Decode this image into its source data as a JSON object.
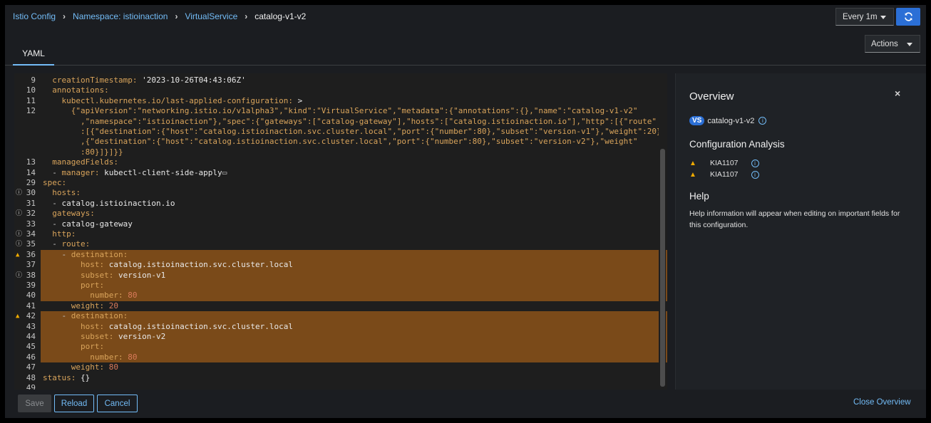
{
  "breadcrumb": {
    "items": [
      "Istio Config",
      "Namespace: istioinaction",
      "VirtualService"
    ],
    "current": "catalog-v1-v2"
  },
  "refresh": {
    "interval_label": "Every 1m"
  },
  "actions_label": "Actions",
  "tabs": {
    "yaml": "YAML"
  },
  "editor": {
    "lines": [
      {
        "n": "9",
        "mark": "",
        "hl": false,
        "html": "  <span class='k'>creationTimestamp:</span> <span class='s'>'2023-10-26T04:43:06Z'</span>"
      },
      {
        "n": "10",
        "mark": "",
        "hl": false,
        "html": "  <span class='k'>annotations:</span>"
      },
      {
        "n": "11",
        "mark": "",
        "hl": false,
        "html": "    <span class='k'>kubectl.kubernetes.io/last-applied-configuration:</span> <span class='s'>&gt;</span>"
      },
      {
        "n": "12",
        "mark": "",
        "hl": false,
        "html": "      <span class='k'>{\"apiVersion\":\"networking.istio.io/v1alpha3\",\"kind\":\"VirtualService\",\"metadata\":{\"annotations\":{},\"name\":\"catalog-v1-v2\"</span>"
      },
      {
        "n": "",
        "mark": "",
        "hl": false,
        "html": "        <span class='k'>,\"namespace\":\"istioinaction\"},\"spec\":{\"gateways\":[\"catalog-gateway\"],\"hosts\":[\"catalog.istioinaction.io\"],\"http\":[{\"route\"</span>"
      },
      {
        "n": "",
        "mark": "",
        "hl": false,
        "html": "        <span class='k'>:[{\"destination\":{\"host\":\"catalog.istioinaction.svc.cluster.local\",\"port\":{\"number\":80},\"subset\":\"version-v1\"},\"weight\":20}</span>"
      },
      {
        "n": "",
        "mark": "",
        "hl": false,
        "html": "        <span class='k'>,{\"destination\":{\"host\":\"catalog.istioinaction.svc.cluster.local\",\"port\":{\"number\":80},\"subset\":\"version-v2\"},\"weight\"</span>"
      },
      {
        "n": "",
        "mark": "",
        "hl": false,
        "html": "        <span class='k'>:80}]}]}}</span>"
      },
      {
        "n": "13",
        "mark": "",
        "hl": false,
        "html": "  <span class='k'>managedFields:</span>"
      },
      {
        "n": "14",
        "mark": "",
        "hl": false,
        "html": "  <span class='p'>-</span> <span class='k'>manager:</span> <span class='s'>kubectl-client-side-apply</span><span class='p'>▭</span>"
      },
      {
        "n": "29",
        "mark": "",
        "hl": false,
        "html": "<span class='k'>spec:</span>"
      },
      {
        "n": "30",
        "mark": "i",
        "hl": false,
        "html": "  <span class='k'>hosts:</span>"
      },
      {
        "n": "31",
        "mark": "",
        "hl": false,
        "html": "  <span class='p'>-</span> <span class='s'>catalog.istioinaction.io</span>"
      },
      {
        "n": "32",
        "mark": "i",
        "hl": false,
        "html": "  <span class='k'>gateways:</span>"
      },
      {
        "n": "33",
        "mark": "",
        "hl": false,
        "html": "  <span class='p'>-</span> <span class='s'>catalog-gateway</span>"
      },
      {
        "n": "34",
        "mark": "i",
        "hl": false,
        "html": "  <span class='k'>http:</span>"
      },
      {
        "n": "35",
        "mark": "i",
        "hl": false,
        "html": "  <span class='p'>-</span> <span class='k'>route:</span>"
      },
      {
        "n": "36",
        "mark": "w",
        "hl": true,
        "html": "    <span class='p'>-</span> <span class='k'>destination:</span>"
      },
      {
        "n": "37",
        "mark": "",
        "hl": true,
        "html": "        <span class='k'>host:</span> <span class='s'>catalog.istioinaction.svc.cluster.local</span>"
      },
      {
        "n": "38",
        "mark": "i",
        "hl": true,
        "html": "        <span class='k'>subset:</span> <span class='s'>version-v1</span>"
      },
      {
        "n": "39",
        "mark": "",
        "hl": true,
        "html": "        <span class='k'>port:</span>"
      },
      {
        "n": "40",
        "mark": "",
        "hl": true,
        "html": "          <span class='k'>number:</span> <span class='n'>80</span>"
      },
      {
        "n": "41",
        "mark": "",
        "hl": false,
        "html": "      <span class='k'>weight:</span> <span class='n'>20</span>"
      },
      {
        "n": "42",
        "mark": "w",
        "hl": true,
        "html": "    <span class='p'>-</span> <span class='k'>destination:</span>"
      },
      {
        "n": "43",
        "mark": "",
        "hl": true,
        "html": "        <span class='k'>host:</span> <span class='s'>catalog.istioinaction.svc.cluster.local</span>"
      },
      {
        "n": "44",
        "mark": "",
        "hl": true,
        "html": "        <span class='k'>subset:</span> <span class='s'>version-v2</span>"
      },
      {
        "n": "45",
        "mark": "",
        "hl": true,
        "html": "        <span class='k'>port:</span>"
      },
      {
        "n": "46",
        "mark": "",
        "hl": true,
        "html": "          <span class='k'>number:</span> <span class='n'>80</span>"
      },
      {
        "n": "47",
        "mark": "",
        "hl": false,
        "html": "      <span class='k'>weight:</span> <span class='n'>80</span>"
      },
      {
        "n": "48",
        "mark": "",
        "hl": false,
        "html": "<span class='k'>status:</span> <span class='s'>{}</span>"
      },
      {
        "n": "49",
        "mark": "",
        "hl": false,
        "html": ""
      }
    ]
  },
  "buttons": {
    "save": "Save",
    "reload": "Reload",
    "cancel": "Cancel"
  },
  "close_overview": "Close Overview",
  "overview": {
    "title": "Overview",
    "close_symbol": "×",
    "badge": "VS",
    "name": "catalog-v1-v2",
    "info_symbol": "i",
    "analysis_title": "Configuration Analysis",
    "validations": [
      {
        "code": "KIA1107"
      },
      {
        "code": "KIA1107"
      }
    ],
    "help_title": "Help",
    "help_text": "Help information will appear when editing on important fields for this configuration."
  },
  "colors": {
    "accent": "#2b6fd6",
    "link": "#73bcf7",
    "highlight": "#7a4a19",
    "warning": "#f0ab00"
  }
}
